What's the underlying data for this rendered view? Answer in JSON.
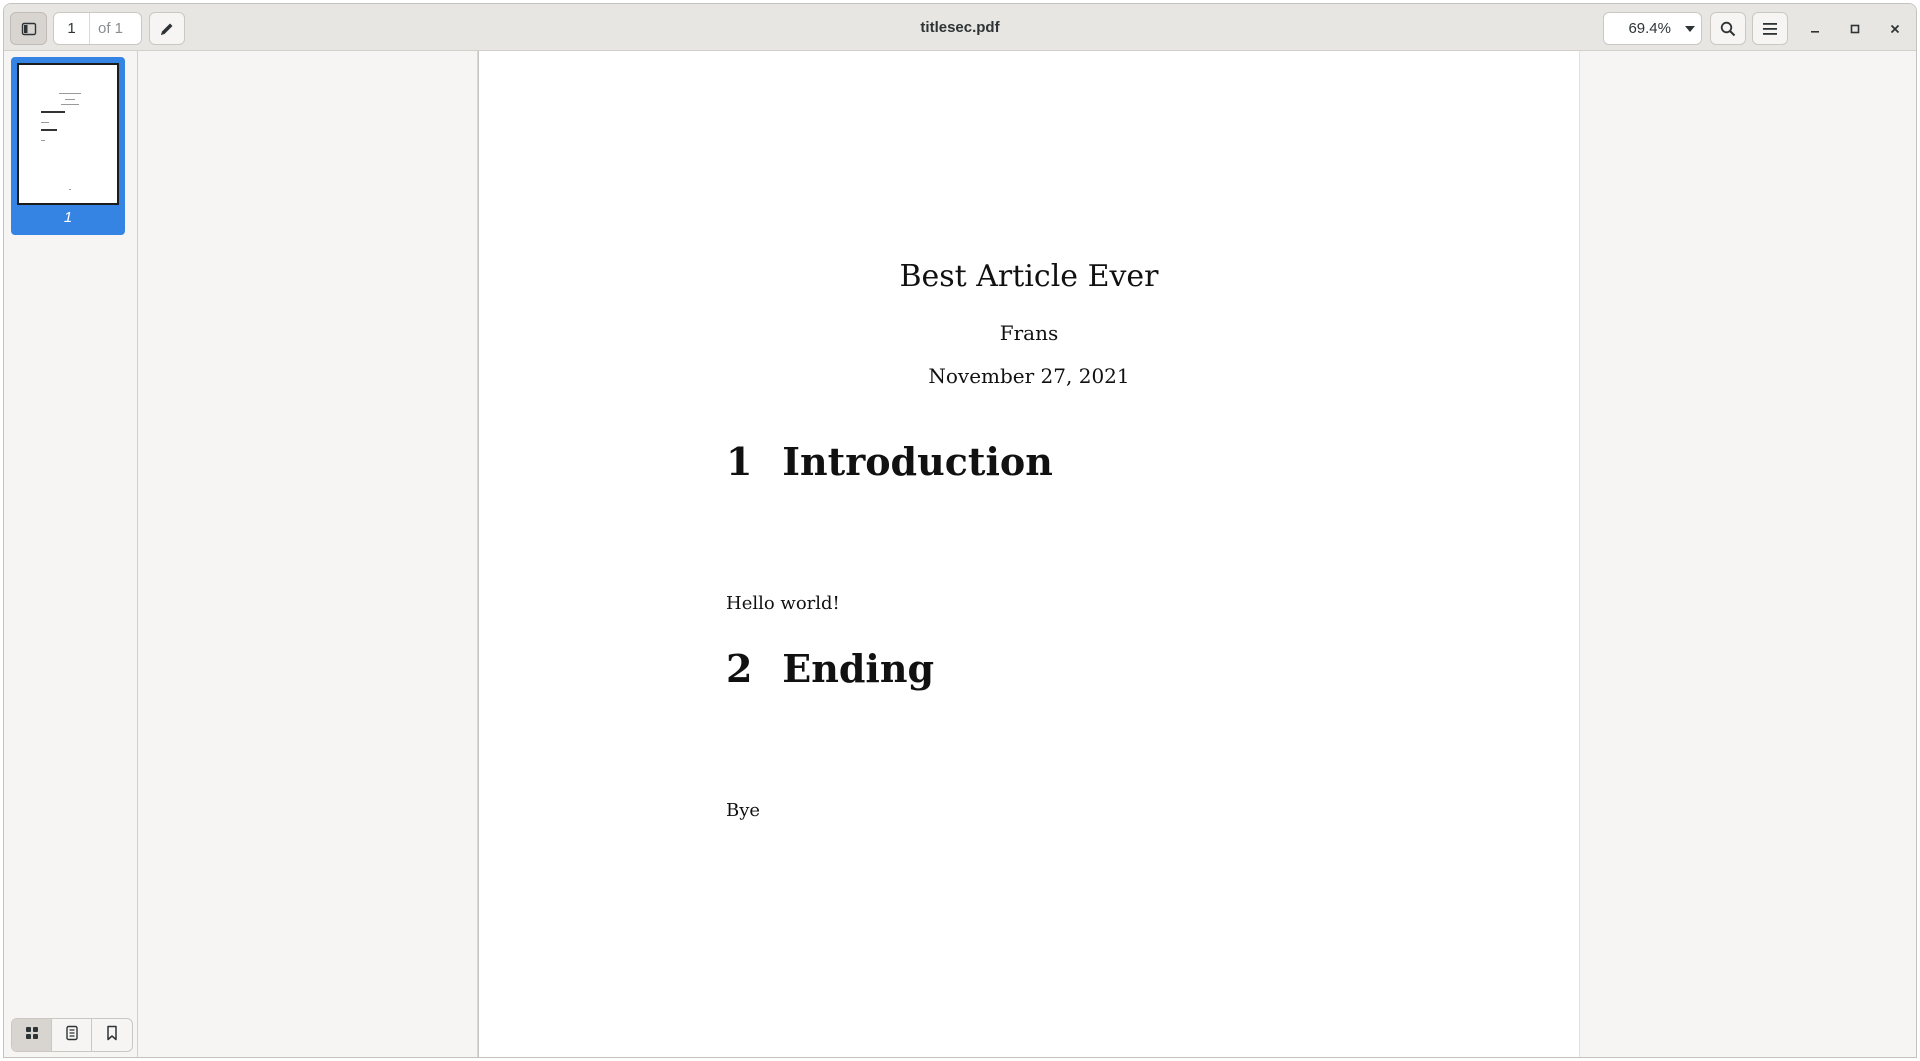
{
  "window": {
    "title": "titlesec.pdf"
  },
  "toolbar": {
    "page_current": "1",
    "page_total": "of 1",
    "zoom": "69.4%"
  },
  "icons": {
    "sidebar_toggle": "sidebar-toggle-icon",
    "edit": "pencil-icon",
    "search": "search-icon",
    "menu": "hamburger-menu-icon",
    "minimize": "minimize-icon",
    "maximize": "maximize-icon",
    "close": "close-icon",
    "thumbnails_tab": "grid-icon",
    "outline_tab": "document-outline-icon",
    "bookmarks_tab": "bookmark-icon"
  },
  "sidebar": {
    "thumbnails": [
      {
        "label": "1",
        "selected": true
      }
    ]
  },
  "document": {
    "title": "Best Article Ever",
    "author": "Frans",
    "date": "November 27, 2021",
    "sections": [
      {
        "number": "1",
        "heading": "Introduction",
        "body": "Hello world!"
      },
      {
        "number": "2",
        "heading": "Ending",
        "body": "Bye"
      }
    ]
  },
  "colors": {
    "accent": "#3584e4",
    "headerbar": "#e8e6e3",
    "background": "#f6f5f4",
    "page": "#ffffff"
  }
}
